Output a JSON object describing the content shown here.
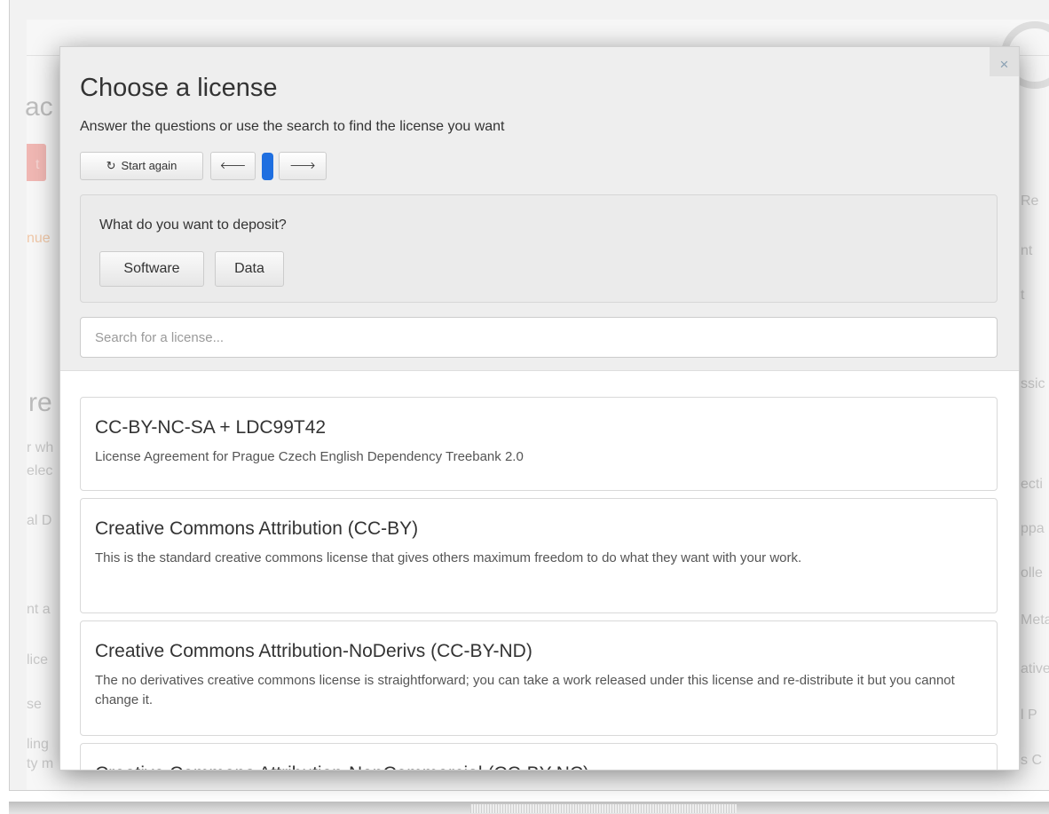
{
  "background": {
    "fragments": [
      "ac",
      "re",
      "t",
      "nue",
      "r wh",
      "elec",
      "al D",
      "nt a",
      "lice",
      "se",
      "ling",
      "ty m",
      "Re",
      "nt",
      "t",
      "ssic",
      "ecti",
      "ppa",
      "olle",
      "Meta",
      "ative",
      "l P",
      "s C"
    ]
  },
  "modal": {
    "title": "Choose a license",
    "subtitle": "Answer the questions or use the search to find the license you want",
    "close_label": "×",
    "start_again_label": "Start again",
    "prev_label": "🡐",
    "next_label": "🡒",
    "question": "What do you want to deposit?",
    "answers": [
      "Software",
      "Data"
    ],
    "search_placeholder": "Search for a license..."
  },
  "licenses": [
    {
      "title": "CC-BY-NC-SA + LDC99T42",
      "description": "License Agreement for Prague Czech English Dependency Treebank 2.0"
    },
    {
      "title": "Creative Commons Attribution (CC-BY)",
      "description": "This is the standard creative commons license that gives others maximum freedom to do what they want with your work."
    },
    {
      "title": "Creative Commons Attribution-NoDerivs (CC-BY-ND)",
      "description": "The no derivatives creative commons license is straightforward; you can take a work released under this license and re-distribute it but you cannot change it."
    },
    {
      "title": "Creative Commons Attribution-NonCommercial (CC-BY-NC)",
      "description": ""
    }
  ],
  "colors": {
    "progress": "#1f6fe0",
    "header_bg": "#eeeeee"
  }
}
